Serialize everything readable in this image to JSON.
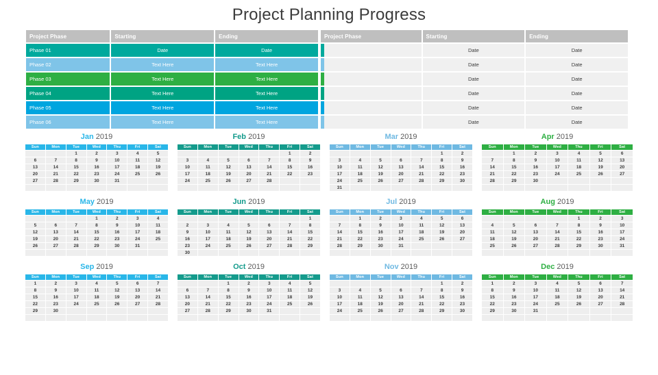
{
  "title": "Project Planning Progress",
  "colors": {
    "header_gray": "#bfbfbf",
    "teal": "#00a99d",
    "light_blue": "#7fc4e8",
    "green": "#2eaf43",
    "cyan": "#00a5df",
    "cell_gray": "#f0f0f0"
  },
  "tables": {
    "left": {
      "headers": [
        "Project Phase",
        "Starting",
        "Ending"
      ],
      "rows": [
        {
          "phase": "Phase 01",
          "starting": "Date",
          "ending": "Date",
          "color": "#00a99d"
        },
        {
          "phase": "Phase 02",
          "starting": "Text Here",
          "ending": "Text Here",
          "color": "#7fc4e8"
        },
        {
          "phase": "Phase 03",
          "starting": "Text Here",
          "ending": "Text Here",
          "color": "#2eaf43"
        },
        {
          "phase": "Phase 04",
          "starting": "Text Here",
          "ending": "Text Here",
          "color": "#00a383"
        },
        {
          "phase": "Phase 05",
          "starting": "Text Here",
          "ending": "Text Here",
          "color": "#00a5df"
        },
        {
          "phase": "Phase 06",
          "starting": "Text Here",
          "ending": "Text Here",
          "color": "#7fc4e8"
        }
      ]
    },
    "right": {
      "headers": [
        "Project Phase",
        "Starting",
        "Ending"
      ],
      "rows": [
        {
          "phase": "",
          "starting": "Date",
          "ending": "Date",
          "color": "#00a99d"
        },
        {
          "phase": "",
          "starting": "Date",
          "ending": "Date",
          "color": "#7fc4e8"
        },
        {
          "phase": "",
          "starting": "Date",
          "ending": "Date",
          "color": "#2eaf43"
        },
        {
          "phase": "",
          "starting": "Date",
          "ending": "Date",
          "color": "#00a383"
        },
        {
          "phase": "",
          "starting": "Date",
          "ending": "Date",
          "color": "#00a5df"
        },
        {
          "phase": "",
          "starting": "Date",
          "ending": "Date",
          "color": "#7fc4e8"
        }
      ]
    }
  },
  "calendar": {
    "year": "2019",
    "weekdays": [
      "Sun",
      "Mon",
      "Tue",
      "Wed",
      "Thu",
      "Fri",
      "Sat"
    ],
    "months": [
      {
        "name": "Jan",
        "color": "#29b6e8",
        "start": 2,
        "days": 31
      },
      {
        "name": "Feb",
        "color": "#149b8c",
        "start": 5,
        "days": 28
      },
      {
        "name": "Mar",
        "color": "#6fb9e2",
        "start": 5,
        "days": 31
      },
      {
        "name": "Apr",
        "color": "#2eaf43",
        "start": 1,
        "days": 30
      },
      {
        "name": "May",
        "color": "#29b6e8",
        "start": 3,
        "days": 31
      },
      {
        "name": "Jun",
        "color": "#149b8c",
        "start": 6,
        "days": 30
      },
      {
        "name": "Jul",
        "color": "#6fb9e2",
        "start": 1,
        "days": 31
      },
      {
        "name": "Aug",
        "color": "#2eaf43",
        "start": 4,
        "days": 31
      },
      {
        "name": "Sep",
        "color": "#29b6e8",
        "start": 0,
        "days": 30
      },
      {
        "name": "Oct",
        "color": "#149b8c",
        "start": 2,
        "days": 31
      },
      {
        "name": "Nov",
        "color": "#6fb9e2",
        "start": 5,
        "days": 30
      },
      {
        "name": "Dec",
        "color": "#2eaf43",
        "start": 0,
        "days": 31
      }
    ]
  }
}
